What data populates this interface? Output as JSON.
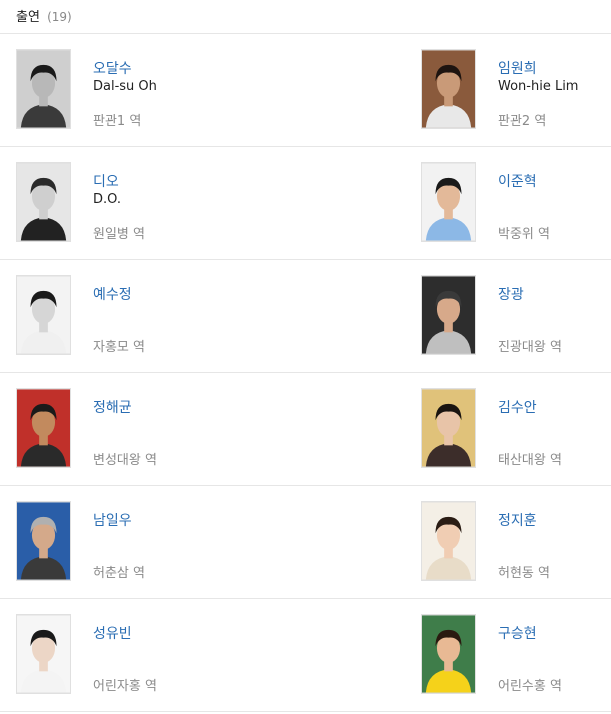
{
  "section": {
    "title": "출연",
    "count": "(19)"
  },
  "rows": [
    {
      "left": {
        "name": "오달수",
        "ename": "Dal-su Oh",
        "role": "판관1 역",
        "photo": {
          "bg": "#cfcfcf",
          "skin": "#b8b8b8",
          "hair": "#1a1a1a",
          "cloth": "#3a3a3a"
        }
      },
      "right": {
        "name": "임원희",
        "ename": "Won-hie Lim",
        "role": "판관2 역",
        "photo": {
          "bg": "#8a5a3c",
          "skin": "#c99a78",
          "hair": "#1e1410",
          "cloth": "#e8e8e8"
        }
      }
    },
    {
      "left": {
        "name": "디오",
        "ename": "D.O.",
        "role": "원일병 역",
        "photo": {
          "bg": "#e6e6e6",
          "skin": "#cfcfcf",
          "hair": "#2a2a2a",
          "cloth": "#222222"
        }
      },
      "right": {
        "name": "이준혁",
        "ename": "",
        "role": "박중위 역",
        "photo": {
          "bg": "#f2f2f2",
          "skin": "#e3b999",
          "hair": "#1a1a1a",
          "cloth": "#8cb8e6"
        }
      }
    },
    {
      "left": {
        "name": "예수정",
        "ename": "",
        "role": "자홍모 역",
        "photo": {
          "bg": "#f3f3f3",
          "skin": "#d6d6d6",
          "hair": "#1a1a1a",
          "cloth": "#f0f0f0"
        }
      },
      "right": {
        "name": "장광",
        "ename": "",
        "role": "진광대왕 역",
        "photo": {
          "bg": "#2d2d2d",
          "skin": "#d7a98a",
          "hair": "#3a3a3a",
          "cloth": "#bfbfbf"
        }
      }
    },
    {
      "left": {
        "name": "정해균",
        "ename": "",
        "role": "변성대왕 역",
        "photo": {
          "bg": "#c0302a",
          "skin": "#c28a5e",
          "hair": "#1a1a1a",
          "cloth": "#2a2a2a"
        }
      },
      "right": {
        "name": "김수안",
        "ename": "",
        "role": "태산대왕 역",
        "photo": {
          "bg": "#e0c27a",
          "skin": "#e8c4a8",
          "hair": "#1a1410",
          "cloth": "#3c2d2a"
        }
      }
    },
    {
      "left": {
        "name": "남일우",
        "ename": "",
        "role": "허춘삼 역",
        "photo": {
          "bg": "#2a5ea8",
          "skin": "#d4a98a",
          "hair": "#b0b0b0",
          "cloth": "#3a3a3a"
        }
      },
      "right": {
        "name": "정지훈",
        "ename": "",
        "role": "허현동 역",
        "photo": {
          "bg": "#f4efe6",
          "skin": "#f0cdb3",
          "hair": "#2a1c14",
          "cloth": "#e8dcc8"
        }
      }
    },
    {
      "left": {
        "name": "성유빈",
        "ename": "",
        "role": "어린자홍 역",
        "photo": {
          "bg": "#f6f6f6",
          "skin": "#ecd6c6",
          "hair": "#1a1a1a",
          "cloth": "#f4f4f4"
        }
      },
      "right": {
        "name": "구승현",
        "ename": "",
        "role": "어린수홍 역",
        "photo": {
          "bg": "#3f7d4a",
          "skin": "#e8b994",
          "hair": "#2a1a10",
          "cloth": "#f5d21a"
        }
      }
    }
  ]
}
